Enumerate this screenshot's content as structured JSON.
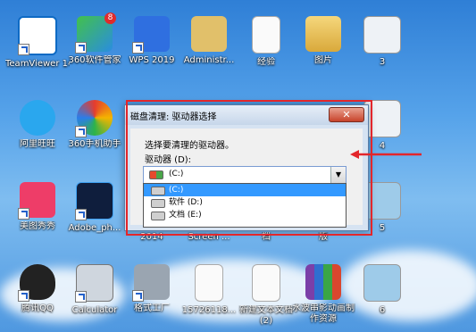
{
  "desktop": {
    "icons": [
      {
        "label": "TeamViewer 14",
        "icon": "teamviewer-icon"
      },
      {
        "label": "360软件管家",
        "icon": "360-software-manager-icon",
        "badge": "8"
      },
      {
        "label": "WPS 2019",
        "icon": "wps-icon"
      },
      {
        "label": "Administr...",
        "icon": "user-folder-icon"
      },
      {
        "label": "经验",
        "icon": "document-icon"
      },
      {
        "label": "图片",
        "icon": "folder-icon"
      },
      {
        "label": "3",
        "icon": "image-file-icon"
      },
      {
        "label": "阿里旺旺",
        "icon": "aliwangwang-icon"
      },
      {
        "label": "360手机助手",
        "icon": "360-phone-assistant-icon"
      },
      {
        "label": "4",
        "icon": "image-file-icon"
      },
      {
        "label": "美图秀秀",
        "icon": "meitu-icon"
      },
      {
        "label": "Adobe_ph...",
        "icon": "photoshop-icon"
      },
      {
        "label": "2014",
        "icon": "file-icon"
      },
      {
        "label": "Screen ...",
        "icon": "file-icon"
      },
      {
        "label": "档",
        "icon": "file-icon"
      },
      {
        "label": "版",
        "icon": "file-icon"
      },
      {
        "label": "5",
        "icon": "image-file-icon"
      },
      {
        "label": "腾讯QQ",
        "icon": "qq-icon"
      },
      {
        "label": "Calculator",
        "icon": "calculator-icon"
      },
      {
        "label": "格式工厂",
        "icon": "format-factory-icon"
      },
      {
        "label": "15726118...",
        "icon": "document-icon"
      },
      {
        "label": "新建文本文档 (2)",
        "icon": "text-file-icon"
      },
      {
        "label": "水波串影动画制作资源",
        "icon": "rar-archive-icon"
      },
      {
        "label": "6",
        "icon": "image-file-icon"
      }
    ]
  },
  "dialog": {
    "title": "磁盘清理: 驱动器选择",
    "close_label": "✕",
    "prompt": "选择要清理的驱动器。",
    "drive_label": "驱动器 (D):",
    "selected_drive": "(C:)",
    "drive_options": [
      {
        "label": "(C:)"
      },
      {
        "label": "软件 (D:)"
      },
      {
        "label": "文档 (E:)"
      }
    ]
  },
  "colors": {
    "highlight": "#e3262b",
    "selection": "#3399ff"
  }
}
